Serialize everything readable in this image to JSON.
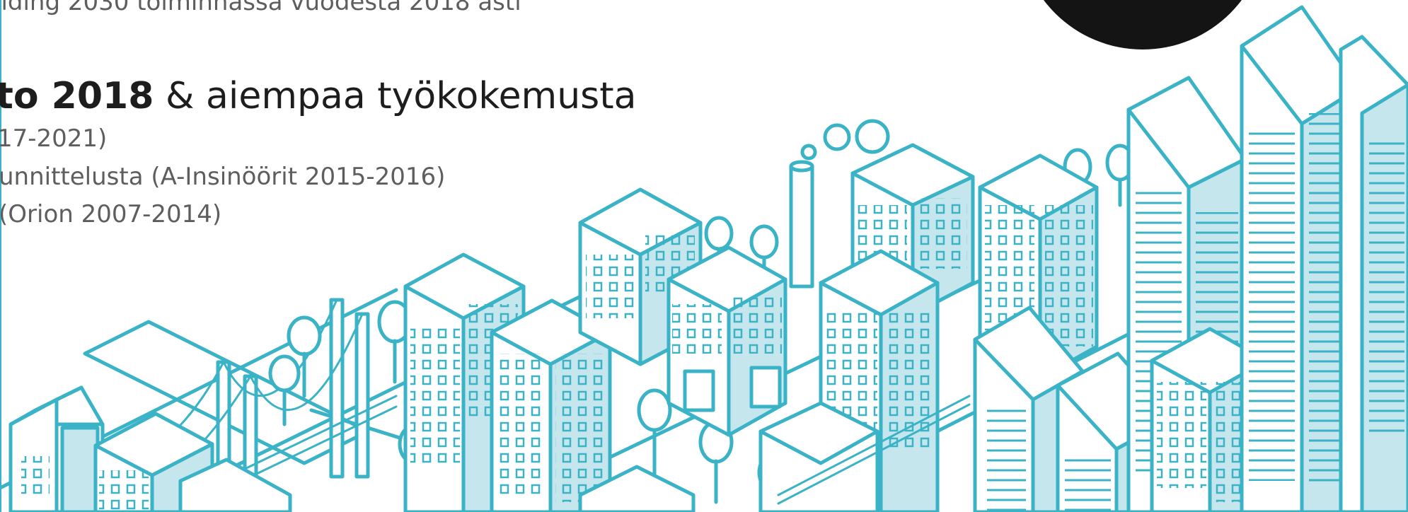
{
  "intro": {
    "line_top": "ilding 2030 toiminnassa vuodesta 2018 asti"
  },
  "heading": {
    "bold_part": "to 2018",
    "rest": " & aiempaa työkokemusta"
  },
  "experience": [
    "17-2021)",
    "unnittelusta (A-Insinöörit 2015-2016)",
    "(Orion 2007-2014)"
  ],
  "colors": {
    "accent": "#3ab3c6",
    "fill_light": "#c6e6ee",
    "text_gray": "#5e5e5e",
    "text_dark": "#1d1d1d",
    "avatar": "#141414"
  },
  "illustration": {
    "icon": "isometric-city-illustration-icon"
  }
}
